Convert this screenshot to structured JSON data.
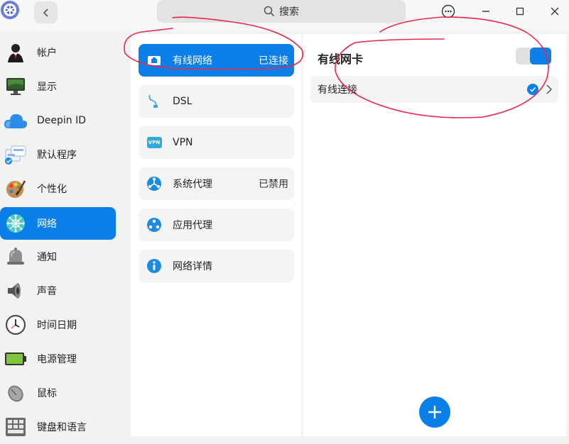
{
  "titlebar": {
    "search_placeholder": "搜索"
  },
  "sidebar": {
    "items": [
      {
        "label": "帐户",
        "icon": "account-icon"
      },
      {
        "label": "显示",
        "icon": "display-icon"
      },
      {
        "label": "Deepin ID",
        "icon": "cloud-icon"
      },
      {
        "label": "默认程序",
        "icon": "default-apps-icon"
      },
      {
        "label": "个性化",
        "icon": "personalization-icon"
      },
      {
        "label": "网络",
        "icon": "network-icon",
        "active": true
      },
      {
        "label": "通知",
        "icon": "bell-icon"
      },
      {
        "label": "声音",
        "icon": "speaker-icon"
      },
      {
        "label": "时间日期",
        "icon": "clock-icon"
      },
      {
        "label": "电源管理",
        "icon": "battery-icon"
      },
      {
        "label": "鼠标",
        "icon": "mouse-icon"
      },
      {
        "label": "键盘和语言",
        "icon": "keyboard-icon"
      }
    ]
  },
  "network_menu": {
    "items": [
      {
        "label": "有线网络",
        "status": "已连接",
        "icon": "wired-network-icon",
        "active": true
      },
      {
        "label": "DSL",
        "status": "",
        "icon": "dsl-icon"
      },
      {
        "label": "VPN",
        "status": "",
        "icon": "vpn-icon",
        "icon_text": "VPN"
      },
      {
        "label": "系统代理",
        "status": "已禁用",
        "icon": "system-proxy-icon"
      },
      {
        "label": "应用代理",
        "status": "",
        "icon": "app-proxy-icon"
      },
      {
        "label": "网络详情",
        "status": "",
        "icon": "info-icon"
      }
    ]
  },
  "detail": {
    "title": "有线网卡",
    "toggle_on": true,
    "connection_label": "有线连接",
    "connection_selected": true
  },
  "colors": {
    "accent": "#0a7fe8",
    "annotation": "#e8274a"
  }
}
